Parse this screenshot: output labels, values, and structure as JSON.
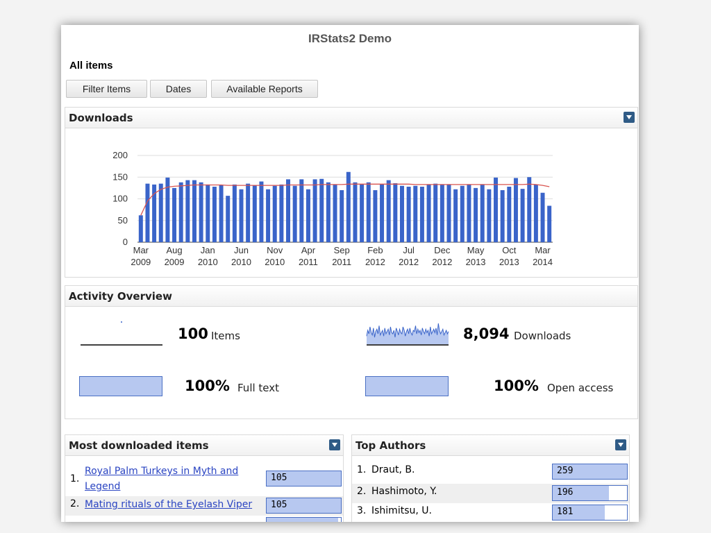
{
  "app_title": "IRStats2 Demo",
  "section_heading": "All items",
  "toolbar": {
    "filter_label": "Filter Items",
    "dates_label": "Dates",
    "reports_label": "Available Reports"
  },
  "downloads_panel": {
    "title": "Downloads"
  },
  "chart_data": {
    "type": "bar",
    "title": "",
    "xlabel": "",
    "ylabel": "",
    "ylim": [
      0,
      200
    ],
    "yticks": [
      0,
      50,
      100,
      150,
      200
    ],
    "grid": true,
    "bar_color": "#3a64c9",
    "trend_color": "#d9534f",
    "tick_labels": [
      {
        "index": 0,
        "month": "Mar",
        "year": "2009"
      },
      {
        "index": 5,
        "month": "Aug",
        "year": "2009"
      },
      {
        "index": 10,
        "month": "Jan",
        "year": "2010"
      },
      {
        "index": 15,
        "month": "Jun",
        "year": "2010"
      },
      {
        "index": 20,
        "month": "Nov",
        "year": "2010"
      },
      {
        "index": 25,
        "month": "Apr",
        "year": "2011"
      },
      {
        "index": 30,
        "month": "Sep",
        "year": "2011"
      },
      {
        "index": 35,
        "month": "Feb",
        "year": "2012"
      },
      {
        "index": 40,
        "month": "Jul",
        "year": "2012"
      },
      {
        "index": 45,
        "month": "Dec",
        "year": "2012"
      },
      {
        "index": 50,
        "month": "May",
        "year": "2013"
      },
      {
        "index": 55,
        "month": "Oct",
        "year": "2013"
      },
      {
        "index": 60,
        "month": "Mar",
        "year": "2014"
      }
    ],
    "series": [
      {
        "values": [
          62,
          135,
          133,
          135,
          149,
          125,
          138,
          143,
          143,
          138,
          133,
          128,
          132,
          107,
          133,
          122,
          135,
          132,
          140,
          122,
          130,
          133,
          145,
          130,
          145,
          122,
          145,
          146,
          138,
          133,
          120,
          162,
          138,
          133,
          138,
          120,
          133,
          143,
          136,
          130,
          128,
          130,
          128,
          133,
          135,
          132,
          133,
          122,
          130,
          133,
          125,
          132,
          122,
          149,
          120,
          128,
          148,
          123,
          150,
          133,
          114,
          84
        ],
        "trend": [
          62,
          95,
          112,
          122,
          127,
          129,
          130,
          131,
          132,
          132,
          132,
          132,
          132,
          131,
          131,
          131,
          131,
          131,
          131,
          131,
          131,
          131,
          132,
          132,
          132,
          132,
          132,
          133,
          133,
          133,
          133,
          134,
          134,
          134,
          134,
          134,
          134,
          134,
          134,
          134,
          134,
          133,
          133,
          133,
          133,
          133,
          133,
          133,
          133,
          133,
          133,
          133,
          133,
          133,
          133,
          133,
          133,
          133,
          134,
          133,
          131,
          128
        ]
      }
    ]
  },
  "activity": {
    "title": "Activity Overview",
    "items_value": "100",
    "items_label": "Items",
    "downloads_value": "8,094",
    "downloads_label": "Downloads",
    "fulltext_value": "100%",
    "fulltext_label": "Full text",
    "openaccess_value": "100%",
    "openaccess_label": "Open access",
    "sparkline": [
      7,
      12,
      9,
      15,
      10,
      8,
      14,
      6,
      11,
      13,
      9,
      16,
      8,
      10,
      12,
      7,
      14,
      9,
      11,
      13,
      8,
      15,
      10,
      9,
      12,
      6,
      14,
      11,
      8,
      13,
      10,
      9,
      15,
      12,
      7,
      11,
      13,
      9,
      14,
      10,
      8,
      12,
      11,
      16,
      9,
      13,
      10,
      12,
      8,
      14,
      11,
      9,
      13,
      10,
      12,
      7,
      15,
      9,
      11,
      13,
      10,
      14,
      8,
      18,
      12,
      9,
      11,
      13,
      8,
      10,
      12,
      9,
      11
    ]
  },
  "most_downloaded": {
    "title": "Most downloaded items",
    "items": [
      {
        "rank": "1.",
        "line1": "Royal Palm Turkeys in Myth and",
        "line2": "Legend",
        "count": "105",
        "fraction": 1.0
      },
      {
        "rank": "2.",
        "line1": "Mating rituals of the Eyelash Viper",
        "line2": "",
        "count": "105",
        "fraction": 1.0
      }
    ]
  },
  "top_authors": {
    "title": "Top Authors",
    "items": [
      {
        "rank": "1.",
        "name": "Draut, B.",
        "count": "259",
        "fraction": 1.0
      },
      {
        "rank": "2.",
        "name": "Hashimoto, Y.",
        "count": "196",
        "fraction": 0.757
      },
      {
        "rank": "3.",
        "name": "Ishimitsu, U.",
        "count": "181",
        "fraction": 0.699
      }
    ]
  }
}
